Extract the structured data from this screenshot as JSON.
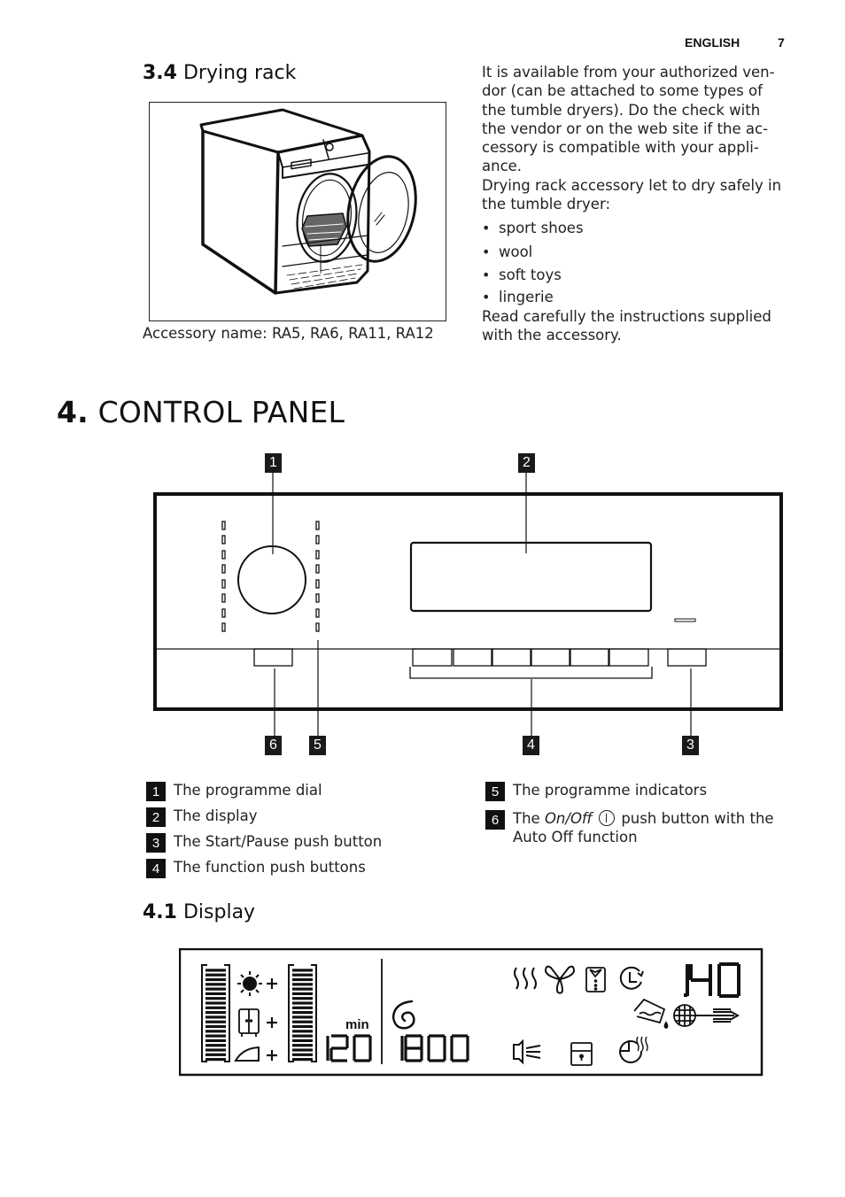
{
  "header": {
    "language": "ENGLISH",
    "page_number": "7"
  },
  "section_3_4": {
    "number": "3.4",
    "title": "Drying rack",
    "figure_caption": "Accessory name: RA5, RA6, RA11, RA12",
    "paragraph_1": "It is available from your authorized ven-dor (can be attached to some types of the tumble dryers). Do the check with the vendor or on the web site if the ac-cessory is compatible with your appli-ance.",
    "paragraph_1_lines": [
      "It is available from your authorized ven-",
      "dor (can be attached to some types of",
      "the tumble dryers). Do the check with",
      "the vendor or on the web site if the ac-",
      "cessory is compatible with your appli-",
      "ance."
    ],
    "paragraph_2_lines": [
      "Drying rack accessory let to dry safely in",
      "the tumble dryer:"
    ],
    "bullets": [
      "sport shoes",
      "wool",
      "soft toys",
      "lingerie"
    ],
    "paragraph_3_lines": [
      "Read carefully the instructions supplied",
      "with the accessory."
    ]
  },
  "section_4": {
    "number": "4.",
    "title": "CONTROL PANEL",
    "callouts": {
      "dial": "1",
      "display": "2",
      "start_pause": "3",
      "function_buttons": "4",
      "programme_indicators": "5",
      "on_off": "6"
    },
    "legend": [
      {
        "num": "1",
        "text": "The programme dial"
      },
      {
        "num": "2",
        "text": "The display"
      },
      {
        "num": "3",
        "text": "The Start/Pause push button"
      },
      {
        "num": "4",
        "text": "The function push buttons"
      },
      {
        "num": "5",
        "text": "The programme indicators"
      }
    ],
    "legend_6": {
      "num": "6",
      "prefix": "The ",
      "italic": "On/Off",
      "icon": "power-icon",
      "suffix": " push button with the",
      "line_2": "Auto Off function"
    }
  },
  "section_4_1": {
    "number": "4.1",
    "title": "Display",
    "lcd": {
      "left_bar_level": 1.0,
      "right_bar_level": 1.0,
      "dryness_icons": [
        "sun-extra-dry-icon",
        "cupboard-dry-icon",
        "iron-dry-icon"
      ],
      "dryness_plus": "+",
      "unit_min": "min",
      "time_minutes": "120",
      "spin_speed": "1800",
      "spiral_icon": "spiral-icon",
      "cycle_time": "1.40",
      "top_icons": [
        "heat-waves-icon",
        "fan-cooling-icon",
        "shirt-icon",
        "delay-clock-icon"
      ],
      "middle_icons": [
        "water-container-icon",
        "filter-icon",
        "airflow-icon"
      ],
      "bottom_icons": [
        "buzzer-icon",
        "child-lock-icon",
        "anti-crease-clock-icon"
      ]
    }
  }
}
